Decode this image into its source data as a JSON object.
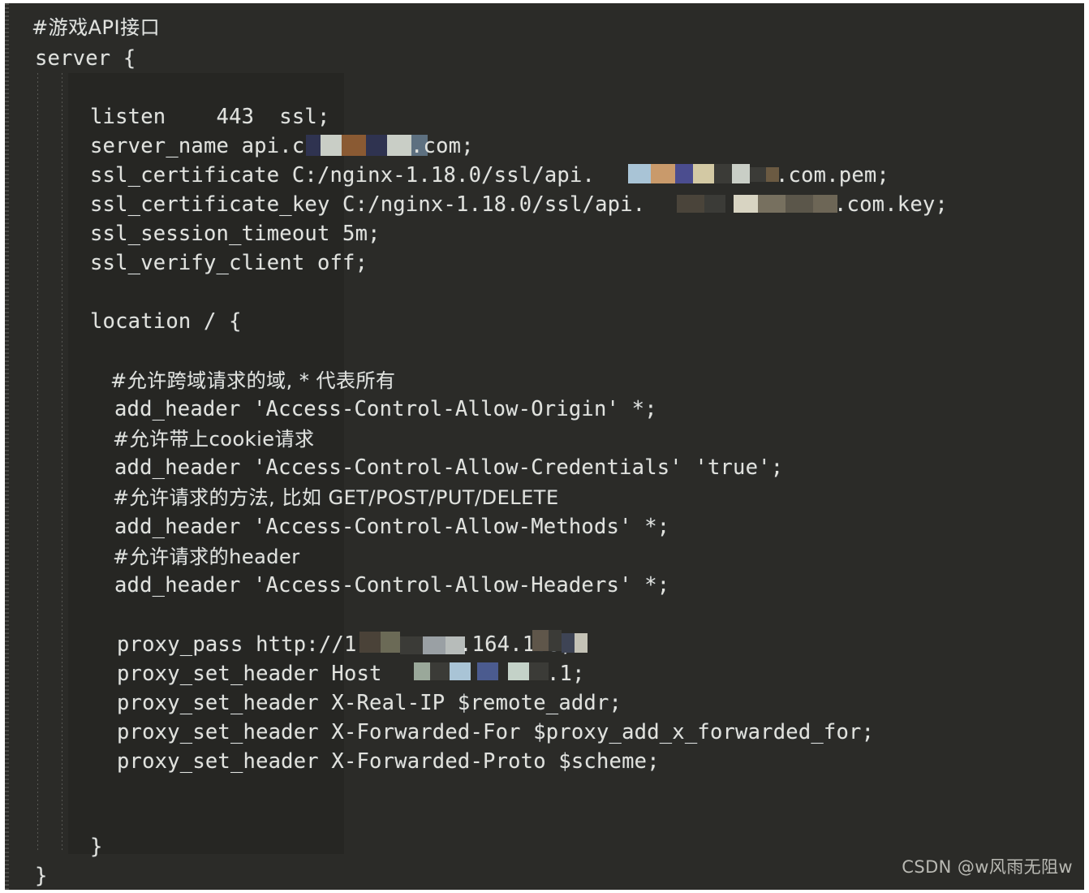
{
  "editor": {
    "background_color": "#2b2b28",
    "text_color": "#e2e2dc",
    "language": "nginx",
    "code_lines": [
      {
        "indent": 0,
        "text": "#游戏API接口",
        "type": "comment",
        "cjk": true
      },
      {
        "indent": 0,
        "text": "server {",
        "type": "code"
      },
      {
        "indent": 0,
        "text": "",
        "type": "blank"
      },
      {
        "indent": 2,
        "text": "listen    443  ssl;",
        "type": "code"
      },
      {
        "indent": 2,
        "text": "server_name api.c",
        "suffix": ".com;",
        "type": "code",
        "redacted": true
      },
      {
        "indent": 2,
        "text": "ssl_certificate C:/nginx-1.18.0/ssl/api.",
        "suffix": ".com.pem;",
        "type": "code",
        "redacted": true
      },
      {
        "indent": 2,
        "text": "ssl_certificate_key C:/nginx-1.18.0/ssl/api.",
        "suffix": ".com.key;",
        "type": "code",
        "redacted": true
      },
      {
        "indent": 2,
        "text": "ssl_session_timeout 5m;",
        "type": "code"
      },
      {
        "indent": 2,
        "text": "ssl_verify_client off;",
        "type": "code"
      },
      {
        "indent": 0,
        "text": "",
        "type": "blank"
      },
      {
        "indent": 2,
        "text": "location / {",
        "type": "code"
      },
      {
        "indent": 0,
        "text": "",
        "type": "blank"
      },
      {
        "indent": 3,
        "text": "#允许跨域请求的域, * 代表所有",
        "type": "comment",
        "cjk": true
      },
      {
        "indent": 3,
        "text": "add_header 'Access-Control-Allow-Origin' *;",
        "type": "code"
      },
      {
        "indent": 3,
        "text": "#允许带上cookie请求",
        "type": "comment",
        "cjk": true
      },
      {
        "indent": 3,
        "text": "add_header 'Access-Control-Allow-Credentials' 'true';",
        "type": "code"
      },
      {
        "indent": 3,
        "text": "#允许请求的方法, 比如 GET/POST/PUT/DELETE",
        "type": "comment",
        "cjk": true
      },
      {
        "indent": 3,
        "text": "add_header 'Access-Control-Allow-Methods' *;",
        "type": "code"
      },
      {
        "indent": 3,
        "text": "#允许请求的header",
        "type": "comment",
        "cjk": true
      },
      {
        "indent": 3,
        "text": "add_header 'Access-Control-Allow-Headers' *;",
        "type": "code"
      },
      {
        "indent": 0,
        "text": "",
        "type": "blank"
      },
      {
        "indent": 3,
        "text": "proxy_pass http://1",
        "suffix": ".164.1:8;",
        "type": "code",
        "redacted": true
      },
      {
        "indent": 3,
        "text": "proxy_set_header Host ",
        "suffix": ".1;",
        "type": "code",
        "redacted": true
      },
      {
        "indent": 3,
        "text": "proxy_set_header X-Real-IP $remote_addr;",
        "type": "code"
      },
      {
        "indent": 3,
        "text": "proxy_set_header X-Forwarded-For $proxy_add_x_forwarded_for;",
        "type": "code"
      },
      {
        "indent": 3,
        "text": "proxy_set_header X-Forwarded-Proto $scheme;",
        "type": "code"
      },
      {
        "indent": 0,
        "text": "",
        "type": "blank"
      },
      {
        "indent": 0,
        "text": "",
        "type": "blank"
      },
      {
        "indent": 2,
        "text": "}",
        "type": "code"
      },
      {
        "indent": 0,
        "text": "}",
        "type": "code"
      }
    ],
    "lines": {
      "l1": "#游戏API接口",
      "l2": "server {",
      "l4": "listen    443  ssl;",
      "l5a": "server_name api.c",
      "l5b": ".com;",
      "l6a": "ssl_certificate C:/nginx-1.18.0/ssl/api.",
      "l6b": ".com.pem;",
      "l7a": "ssl_certificate_key C:/nginx-1.18.0/ssl/api.",
      "l7b": ".com.key;",
      "l8": "ssl_session_timeout 5m;",
      "l9": "ssl_verify_client off;",
      "l11": "location / {",
      "l13": "#允许跨域请求的域, * 代表所有",
      "l14": "add_header 'Access-Control-Allow-Origin' *;",
      "l15": "#允许带上cookie请求",
      "l16": "add_header 'Access-Control-Allow-Credentials' 'true';",
      "l17": "#允许请求的方法, 比如 GET/POST/PUT/DELETE",
      "l18": "add_header 'Access-Control-Allow-Methods' *;",
      "l19": "#允许请求的header",
      "l20": "add_header 'Access-Control-Allow-Headers' *;",
      "l22a": "proxy_pass http://1",
      "l22b": ".164.1:8;",
      "l23a": "proxy_set_header Host ",
      "l23b": ".1;",
      "l24": "proxy_set_header X-Real-IP $remote_addr;",
      "l25": "proxy_set_header X-Forwarded-For $proxy_add_x_forwarded_for;",
      "l26": "proxy_set_header X-Forwarded-Proto $scheme;",
      "l29": "}",
      "l30": "}"
    }
  },
  "watermark": {
    "text": "CSDN @w风雨无阻w",
    "color": "#b9b9b3"
  },
  "redaction": {
    "note": "mosaic-blurred hostname and IP segments",
    "palette": [
      "#2f3350",
      "#c9cec6",
      "#8a5a33",
      "#a9c4d6",
      "#c99a6b",
      "#4b4d8f",
      "#d3c9a4",
      "#3b3b37",
      "#5d7080",
      "#9aa89a",
      "#6f83b0"
    ]
  }
}
